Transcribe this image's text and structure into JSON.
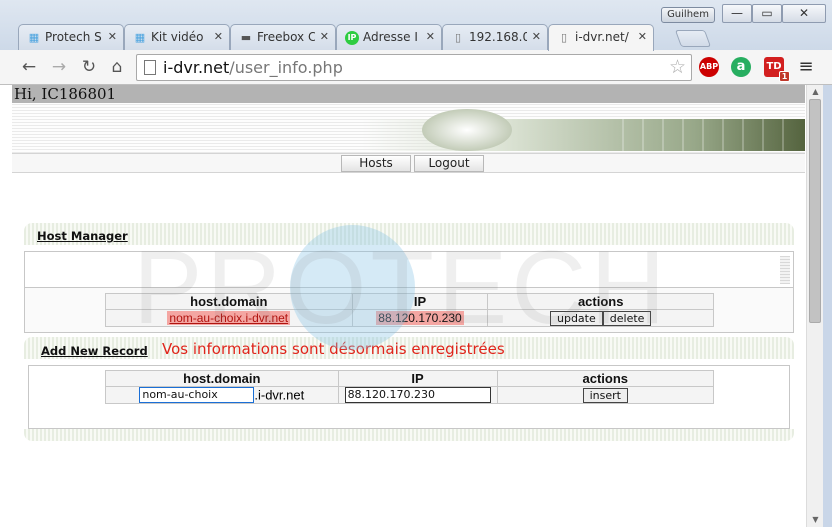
{
  "window": {
    "profile_name": "Guilhem",
    "minimize": "—",
    "maximize": "▭",
    "close": "✕"
  },
  "tabs": [
    {
      "title": "Protech S",
      "icon": "protech-favicon",
      "icon_glyph": "▦",
      "icon_color": "#4aa3df",
      "active": false
    },
    {
      "title": "Kit vidéo",
      "icon": "protech-favicon",
      "icon_glyph": "▦",
      "icon_color": "#4aa3df",
      "active": false
    },
    {
      "title": "Freebox C",
      "icon": "freebox-favicon",
      "icon_glyph": "▬",
      "icon_color": "#555555",
      "active": false
    },
    {
      "title": "Adresse I",
      "icon": "ip-favicon",
      "icon_glyph": "IP",
      "icon_color": "#2ecc40",
      "active": false
    },
    {
      "title": "192.168.0",
      "icon": "page-favicon",
      "icon_glyph": "▯",
      "icon_color": "#777777",
      "active": false
    },
    {
      "title": "i-dvr.net/",
      "icon": "page-favicon",
      "icon_glyph": "▯",
      "icon_color": "#777777",
      "active": true
    }
  ],
  "toolbar": {
    "back": "←",
    "forward": "→",
    "reload": "↻",
    "home": "⌂",
    "url_host": "i-dvr.net",
    "url_path": "/user_info.php",
    "bookmark_star": "☆",
    "extensions": {
      "abp": "ABP",
      "g": "a",
      "td": "TD",
      "td_badge": "1"
    },
    "menu": "≡"
  },
  "page": {
    "greeting": "Hi, IC186801",
    "nav": {
      "hosts": "Hosts",
      "logout": "Logout"
    },
    "watermark": "PROTECH",
    "host_manager": {
      "title": "Host Manager",
      "columns": [
        "host.domain",
        "IP",
        "actions"
      ],
      "rows": [
        {
          "domain": "nom-au-choix.i-dvr.net",
          "ip": "88.120.170.230",
          "update": "update",
          "delete": "delete"
        }
      ]
    },
    "add_record": {
      "title": "Add New Record",
      "message": "Vos informations sont désormais enregistrées",
      "message_color": "#e0251b",
      "columns": [
        "host.domain",
        "IP",
        "actions"
      ],
      "domain_value": "nom-au-choix",
      "domain_suffix": ".i-dvr.net",
      "ip_value": "88.120.170.230",
      "insert": "insert"
    }
  },
  "scrollbar": {
    "up": "▲",
    "down": "▼"
  }
}
